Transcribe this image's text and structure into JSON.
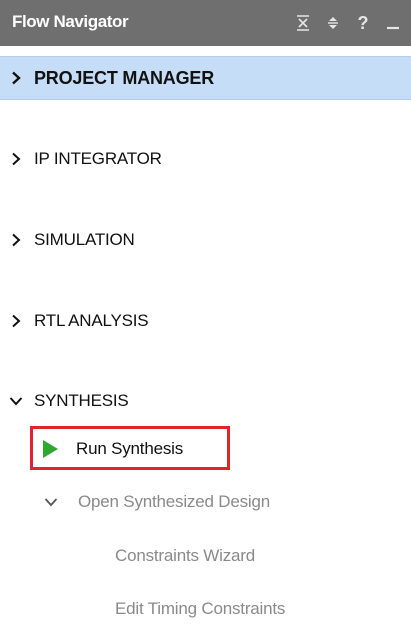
{
  "header": {
    "title": "Flow Navigator",
    "controls": [
      "collapse-all-icon",
      "expand-collapse-icon",
      "help-icon",
      "minimize-icon"
    ],
    "help_glyph": "?"
  },
  "sections": [
    {
      "label": "PROJECT MANAGER",
      "expanded": false,
      "selected": true
    },
    {
      "label": "IP INTEGRATOR",
      "expanded": false
    },
    {
      "label": "SIMULATION",
      "expanded": false
    },
    {
      "label": "RTL ANALYSIS",
      "expanded": false
    },
    {
      "label": "SYNTHESIS",
      "expanded": true
    }
  ],
  "synthesis": {
    "run_label": "Run Synthesis",
    "open_design_label": "Open Synthesized Design",
    "sub_items": [
      "Constraints Wizard",
      "Edit Timing Constraints"
    ]
  },
  "colors": {
    "header_bg": "#6f6f6f",
    "selected_bg": "#c6ddf7",
    "run_icon": "#2fa82f",
    "highlight_border": "#e0262b"
  }
}
